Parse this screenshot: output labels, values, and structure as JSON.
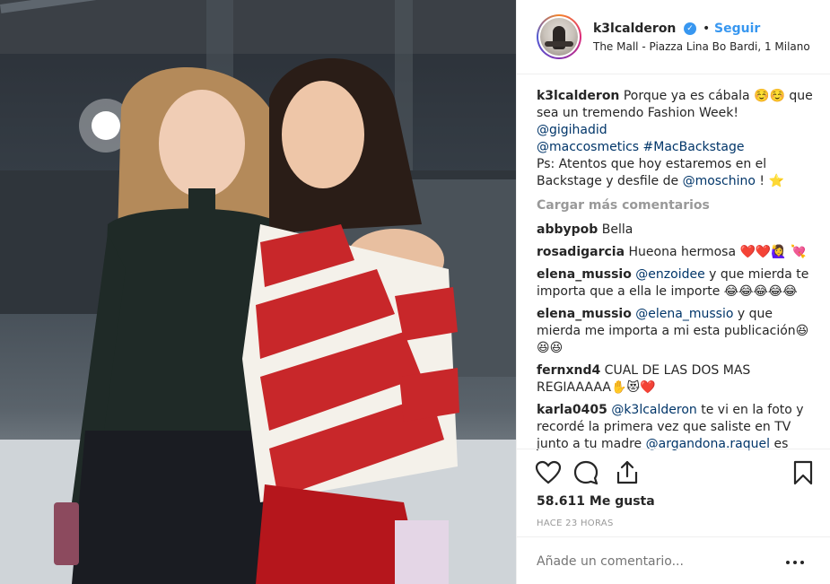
{
  "header": {
    "username": "k3lcalderon",
    "follow_label": "Seguir",
    "separator": "•",
    "location": "The Mall - Piazza Lina Bo Bardi, 1 Milano"
  },
  "caption": {
    "username": "k3lcalderon",
    "line1": "Porque ya es cábala ☺️☺️ que sea un tremendo Fashion Week!",
    "mention1": "@gigihadid",
    "mention2": "@maccosmetics",
    "hashtag": "#MacBackstage",
    "line4": "Ps: Atentos que hoy estaremos en el Backstage y desfile de ",
    "mention3": "@moschino",
    "line4_end": " ! ⭐"
  },
  "load_more_label": "Cargar más comentarios",
  "comments": [
    {
      "user": "abbypob",
      "text": "Bella"
    },
    {
      "user": "rosadigarcia",
      "text": "Hueona hermosa ❤️❤️🙋‍♀️ 💘"
    },
    {
      "user": "elena_mussio",
      "mention": "@enzoidee",
      "text": " y que mierda te importa que a ella le importe 😂😂😂😂😂"
    },
    {
      "user": "elena_mussio",
      "mention": "@elena_mussio",
      "text": " y que mierda me importa a mi esta publicación😆😆😆"
    },
    {
      "user": "fernxnd4",
      "text": "CUAL DE LAS DOS MAS REGIAAAAA✋😻❤️"
    },
    {
      "user": "karla0405",
      "mention": "@k3lcalderon",
      "text": " te vi en la foto y recordé la primera vez que saliste en TV junto a tu madre ",
      "mention2": "@argandona.raquel",
      "text2": " es impactante!"
    }
  ],
  "likes": "58.611 Me gusta",
  "timestamp": "HACE 23 HORAS",
  "add_comment_placeholder": "Añade un comentario...",
  "icons": {
    "like": "heart-icon",
    "comment": "comment-icon",
    "share": "share-icon",
    "save": "bookmark-icon",
    "verified": "verified-badge-icon",
    "more": "more-options-icon"
  },
  "colors": {
    "link": "#003569",
    "follow": "#3897f0",
    "muted": "#999999",
    "verified": "#3897f0"
  }
}
